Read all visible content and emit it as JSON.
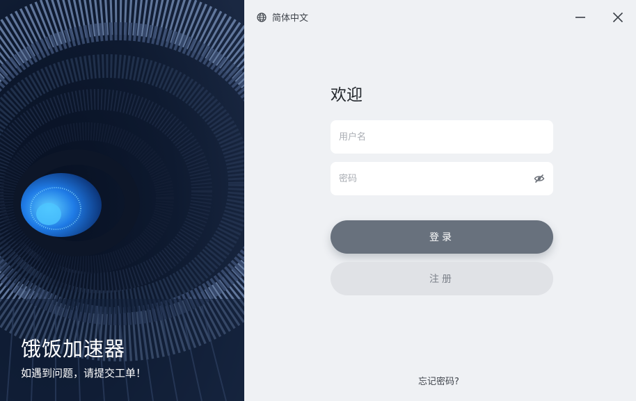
{
  "brand": {
    "title": "饿饭加速器",
    "subtitle": "如遇到问题，请提交工单！"
  },
  "header": {
    "language": "简体中文",
    "language_icon": "globe-icon",
    "minimize_icon": "minimize-icon",
    "close_icon": "close-icon"
  },
  "login": {
    "welcome": "欢迎",
    "username_placeholder": "用户名",
    "password_placeholder": "密码",
    "password_toggle_icon": "eye-off-icon",
    "login_button": "登录",
    "register_button": "注册",
    "forgot_password": "忘记密码?"
  },
  "colors": {
    "background": "#eff1f4",
    "login_button": "#68717d",
    "register_button": "#e0e2e6",
    "art_dark": "#0b1426",
    "art_blue": "#1f7be6"
  }
}
